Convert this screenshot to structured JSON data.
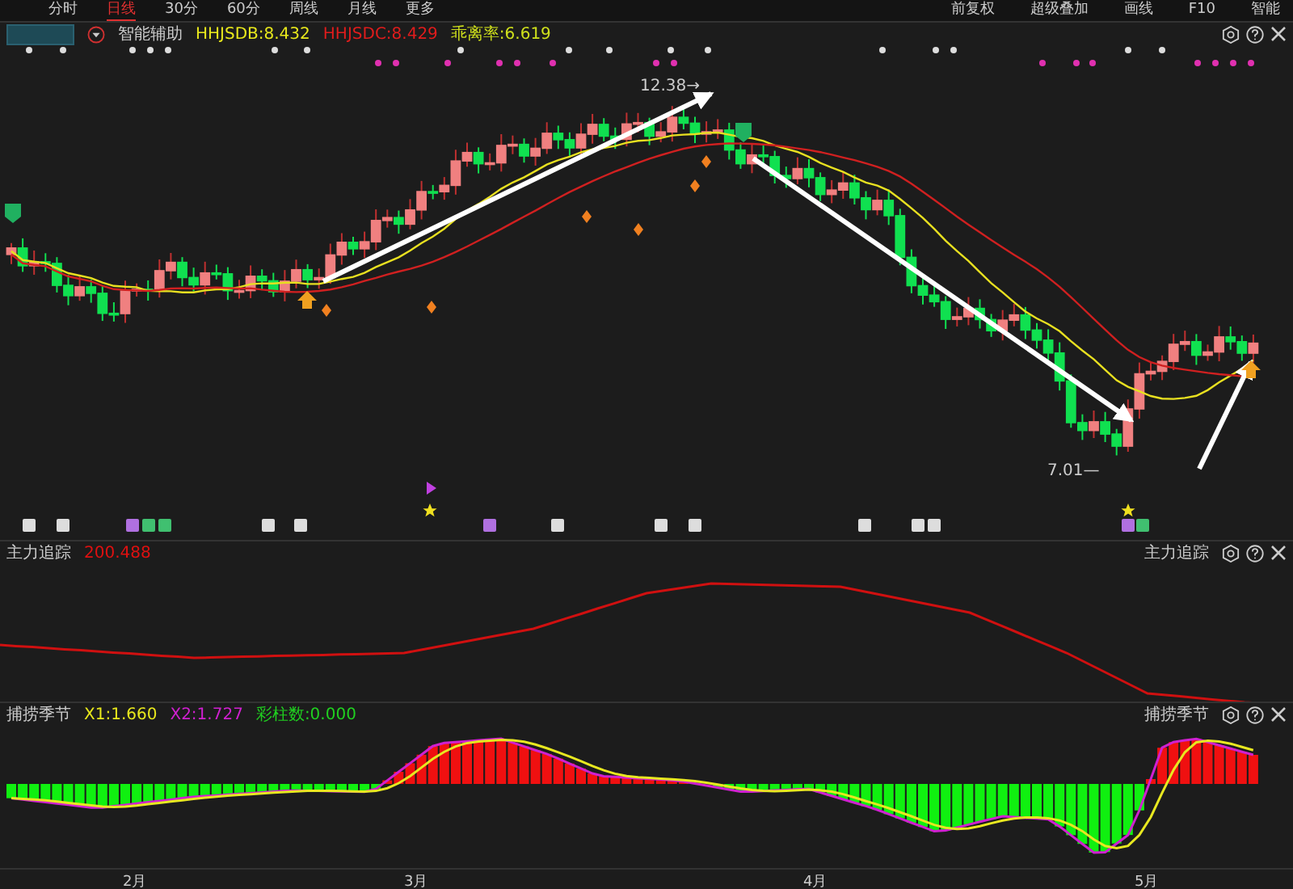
{
  "top_tabs": [
    {
      "label": "分时",
      "selected": false
    },
    {
      "label": "日线",
      "selected": true
    },
    {
      "label": "30分",
      "selected": false
    },
    {
      "label": "60分",
      "selected": false
    },
    {
      "label": "周线",
      "selected": false
    },
    {
      "label": "月线",
      "selected": false
    },
    {
      "label": "更多",
      "selected": false
    }
  ],
  "top_actions": [
    "前复权",
    "超级叠加",
    "画线",
    "F10",
    "智能"
  ],
  "main_panel": {
    "indicator": "智能辅助",
    "readouts": [
      {
        "text": "HHJSDB:8.432",
        "color": "#e8e81c"
      },
      {
        "text": "HHJSDC:8.429",
        "color": "#e01c1c"
      },
      {
        "text": "乖离率:6.619",
        "color": "#cfe01c"
      }
    ],
    "price_labels": [
      "12.38→",
      "7.01—"
    ]
  },
  "trend_panel": {
    "title": "主力追踪",
    "readouts": [
      {
        "text": "200.488",
        "color": "#e01010"
      }
    ],
    "title_right": "主力追踪"
  },
  "season_panel": {
    "title": "捕捞季节",
    "readouts": [
      {
        "text": "X1:1.660",
        "color": "#e8e81c"
      },
      {
        "text": "X2:1.727",
        "color": "#d020d0"
      },
      {
        "text": "彩柱数:0.000",
        "color": "#20d020"
      }
    ],
    "title_right": "捕捞季节"
  },
  "x_axis": [
    "2月",
    "3月",
    "4月",
    "5月"
  ]
}
